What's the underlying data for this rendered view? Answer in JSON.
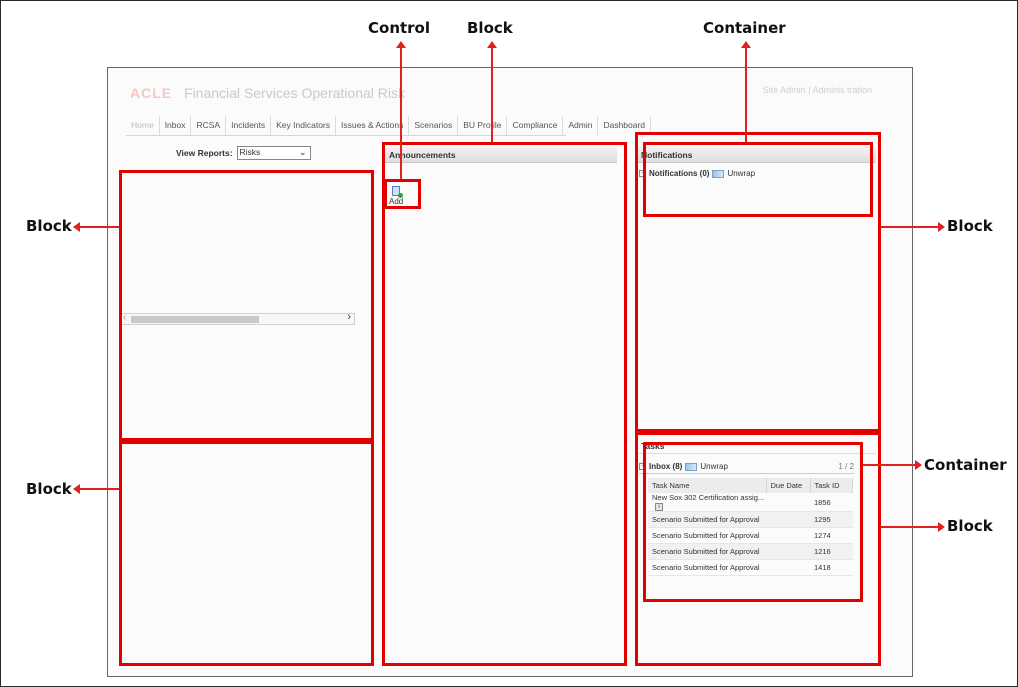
{
  "annotations": {
    "control": "Control",
    "block_top": "Block",
    "container_top": "Container",
    "block_left_upper": "Block",
    "block_left_lower": "Block",
    "block_right_upper": "Block",
    "container_right": "Container",
    "block_right_lower": "Block"
  },
  "app": {
    "brand_logo": "ACLE",
    "brand_title": "Financial Services Operational Risk",
    "top_links": "Site Admin | Adminis tration"
  },
  "tabs": [
    "Home",
    "Inbox",
    "RCSA",
    "Incidents",
    "Key Indicators",
    "Issues & Actions",
    "Scenarios",
    "BU Profile",
    "Compliance",
    "Admin",
    "Dashboard"
  ],
  "view_reports": {
    "label": "View Reports:",
    "value": "Risks"
  },
  "announcements": {
    "title": "Announcements",
    "add_label": "Add"
  },
  "notifications": {
    "panel_title": "Notifications",
    "row_label": "Notifications (0)",
    "unwrap_label": "Unwrap"
  },
  "tasks": {
    "panel_title": "Tasks",
    "inbox_label": "Inbox (8)",
    "unwrap_label": "Unwrap",
    "page_count": "1 / 2",
    "columns": [
      "Task Name",
      "Due Date",
      "Task ID"
    ],
    "rows": [
      {
        "name": "New Sox 302 Certification assig...",
        "due": "",
        "id": "1856"
      },
      {
        "name": "Scenario Submitted for Approval",
        "due": "",
        "id": "1295"
      },
      {
        "name": "Scenario Submitted for Approval",
        "due": "",
        "id": "1274"
      },
      {
        "name": "Scenario Submitted for Approval",
        "due": "",
        "id": "1216"
      },
      {
        "name": "Scenario Submitted for Approval",
        "due": "",
        "id": "1418"
      }
    ]
  },
  "colors": {
    "highlight": "#e50000",
    "arrow": "#e32020"
  }
}
